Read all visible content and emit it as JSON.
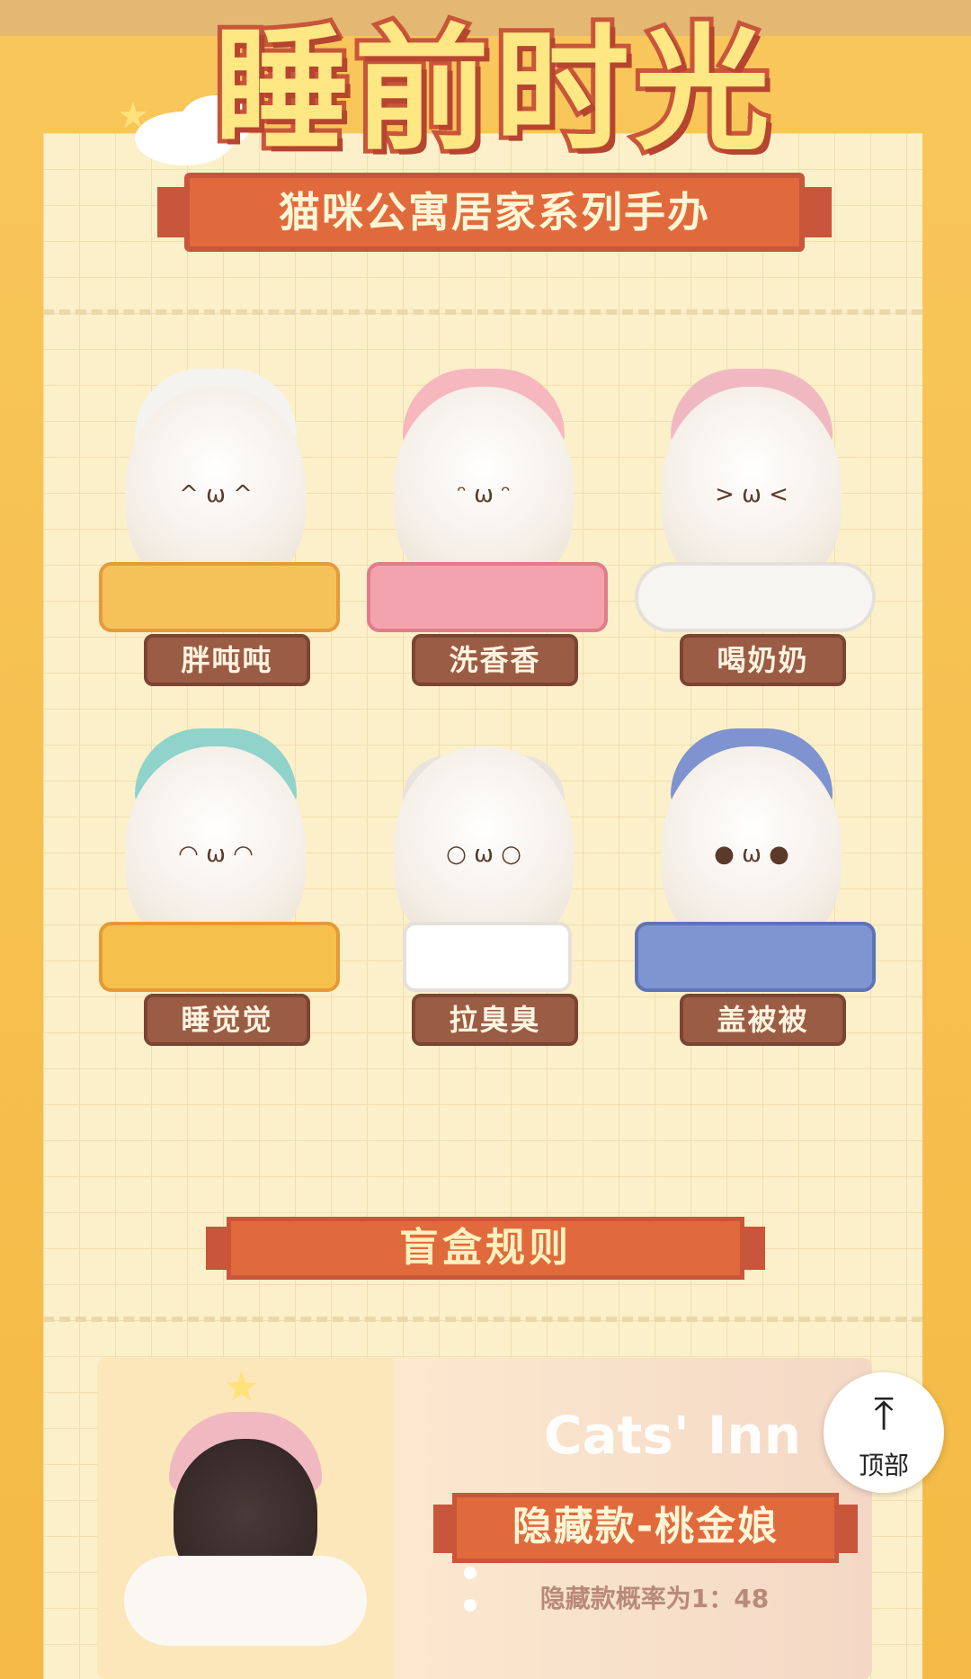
{
  "header": {
    "title": "睡前时光",
    "subtitle": "猫咪公寓居家系列手办"
  },
  "figures": [
    {
      "name": "胖吨吨"
    },
    {
      "name": "洗香香"
    },
    {
      "name": "喝奶奶"
    },
    {
      "name": "睡觉觉"
    },
    {
      "name": "拉臭臭"
    },
    {
      "name": "盖被被"
    }
  ],
  "rules": {
    "banner": "盲盒规则"
  },
  "hidden": {
    "brand": "Cats' Inn",
    "title": "隐藏款-桃金娘",
    "rate": "隐藏款概率为1：48"
  },
  "back_to_top": {
    "icon": "arrow-up-icon",
    "label": "顶部"
  },
  "colors": {
    "background": "#f7c04e",
    "card": "#fbf0c9",
    "banner": "#e06a3c",
    "label": "#9b5c45"
  }
}
